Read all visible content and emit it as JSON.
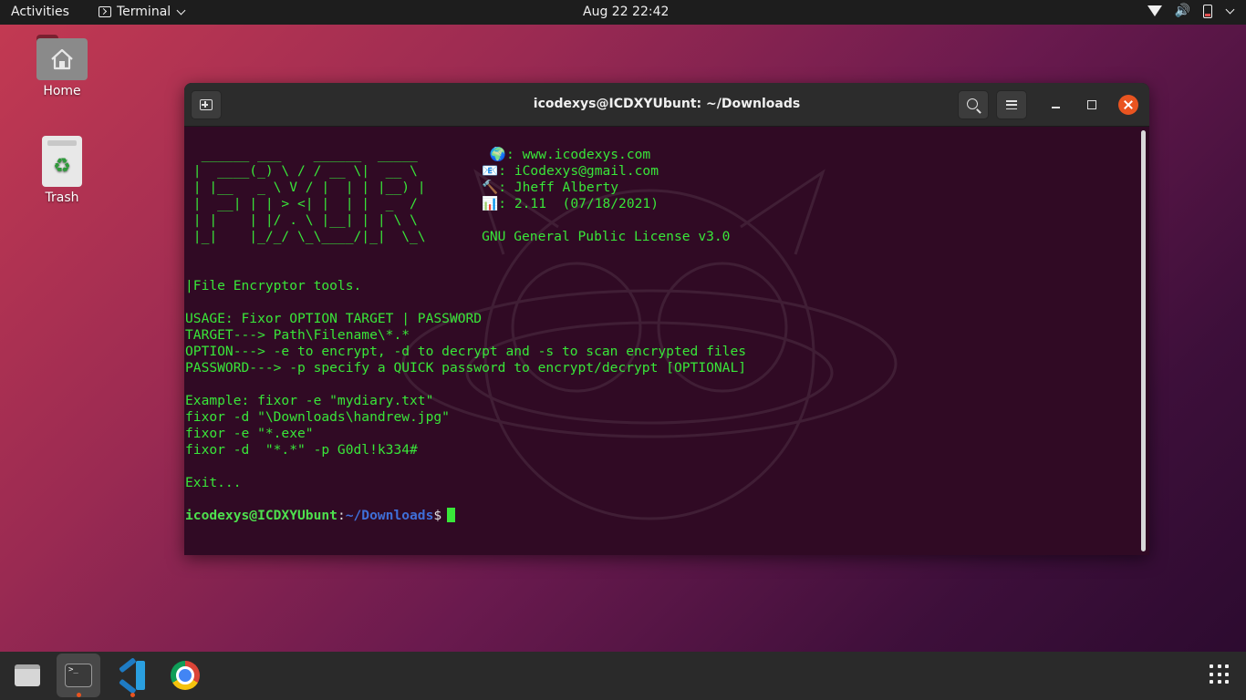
{
  "topbar": {
    "activities": "Activities",
    "app_name": "Terminal",
    "datetime": "Aug 22  22:42"
  },
  "desktop": {
    "home_label": "Home",
    "trash_label": "Trash"
  },
  "window": {
    "title": "icodexys@ICDXYUbunt: ~/Downloads"
  },
  "terminal": {
    "lines": [
      "  ______ ___    ______  _____         🌍: www.icodexys.com",
      " |  ____(_) \\ / / __ \\|  __ \\        📧: iCodexys@gmail.com",
      " | |__   _ \\ V / |  | | |__) |       🔨: Jheff Alberty",
      " |  __| | | > <| |  | |  _  /        📊: 2.11  (07/18/2021)",
      " | |    | |/ . \\ |__| | | \\ \\",
      " |_|    |_/_/ \\_\\____/|_|  \\_\\       GNU General Public License v3.0",
      "",
      "",
      "|File Encryptor tools.",
      "",
      "USAGE: Fixor OPTION TARGET | PASSWORD",
      "TARGET---> Path\\Filename\\*.*",
      "OPTION---> -e to encrypt, -d to decrypt and -s to scan encrypted files",
      "PASSWORD---> -p specify a QUICK password to encrypt/decrypt [OPTIONAL]",
      "",
      "Example: fixor -e \"mydiary.txt\"",
      "fixor -d \"\\Downloads\\handrew.jpg\"",
      "fixor -e \"*.exe\"",
      "fixor -d  \"*.*\" -p G0dl!k334#",
      "",
      "Exit...",
      ""
    ],
    "prompt_user": "icodexys@ICDXYUbunt",
    "prompt_sep": ":",
    "prompt_path": "~/Downloads",
    "prompt_dollar": "$"
  },
  "colors": {
    "terminal_bg": "#300a24",
    "terminal_text": "#39e639",
    "accent": "#e95420",
    "prompt_path": "#3f6fd8"
  },
  "icons": [
    "terminal-icon",
    "chevron-down-icon",
    "wifi-icon",
    "volume-icon",
    "battery-icon",
    "home-folder-icon",
    "trash-icon",
    "new-tab-icon",
    "search-icon",
    "hamburger-menu-icon",
    "minimize-icon",
    "maximize-icon",
    "close-icon",
    "files-icon",
    "vscode-icon",
    "chrome-icon",
    "app-grid-icon"
  ]
}
